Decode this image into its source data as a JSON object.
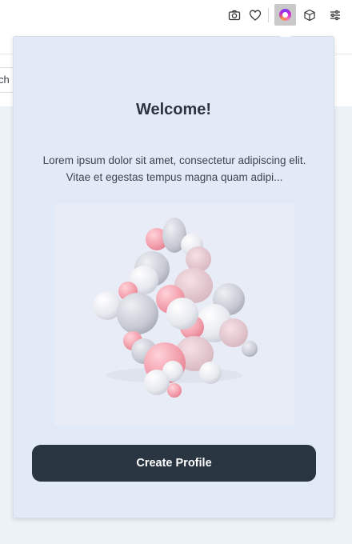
{
  "toolbar": {
    "icons": [
      "camera-icon",
      "heart-icon",
      "extension-logo-icon",
      "cube-icon",
      "sliders-icon"
    ]
  },
  "page": {
    "search_partial_text": "ch"
  },
  "popup": {
    "title": "Welcome!",
    "description": "Lorem ipsum dolor sit amet, consectetur adipiscing elit. Vitae et egestas tempus magna quam adipi...",
    "button_label": "Create Profile",
    "colors": {
      "background": "#e3eaf7",
      "button": "#293540",
      "title": "#2b3440"
    }
  }
}
